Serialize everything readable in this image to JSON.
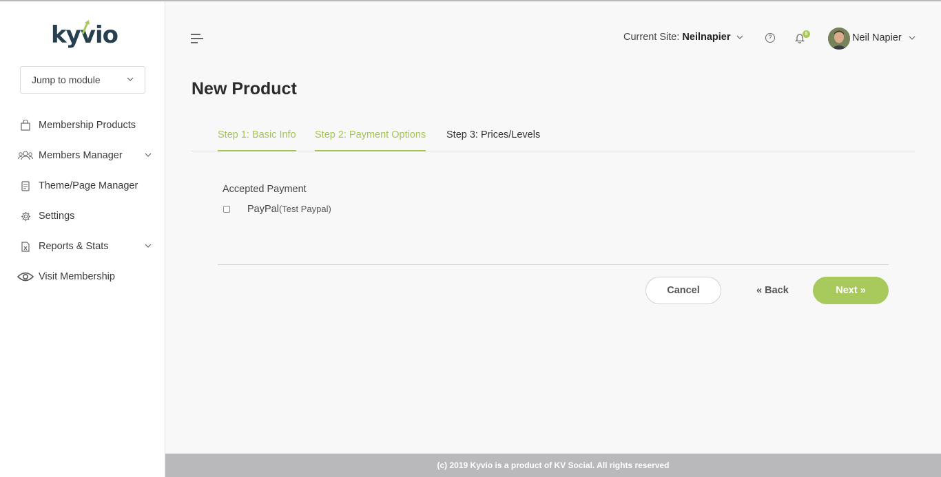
{
  "brand": {
    "name": "kyvio",
    "accent": "#a8c95c",
    "dark": "#27404f"
  },
  "sidebar": {
    "jump_label": "Jump to module",
    "items": [
      {
        "label": "Membership Products",
        "icon": "shopping-bag-icon",
        "expandable": false
      },
      {
        "label": "Members Manager",
        "icon": "users-icon",
        "expandable": true
      },
      {
        "label": "Theme/Page Manager",
        "icon": "document-icon",
        "expandable": false
      },
      {
        "label": "Settings",
        "icon": "gear-icon",
        "expandable": false
      },
      {
        "label": "Reports & Stats",
        "icon": "spreadsheet-icon",
        "expandable": true
      },
      {
        "label": "Visit Membership",
        "icon": "eye-icon",
        "expandable": false
      }
    ]
  },
  "header": {
    "site_label": "Current Site:",
    "site_value": "Neilnapier",
    "help_icon": "question-circle-icon",
    "notification_count": "5",
    "user_name": "Neil Napier"
  },
  "main": {
    "title": "New Product",
    "tabs": [
      {
        "label": "Step 1: Basic Info",
        "state": "done"
      },
      {
        "label": "Step 2: Payment Options",
        "state": "done"
      },
      {
        "label": "Step 3: Prices/Levels",
        "state": "pending"
      }
    ],
    "accepted_payment_label": "Accepted Payment",
    "payment_option": {
      "name": "PayPal",
      "detail": "(Test Paypal)",
      "checked": false
    },
    "buttons": {
      "cancel": "Cancel",
      "back": "« Back",
      "next": "Next »"
    }
  },
  "footer": {
    "text": "(c) 2019 Kyvio is a product of KV Social. All rights reserved"
  }
}
